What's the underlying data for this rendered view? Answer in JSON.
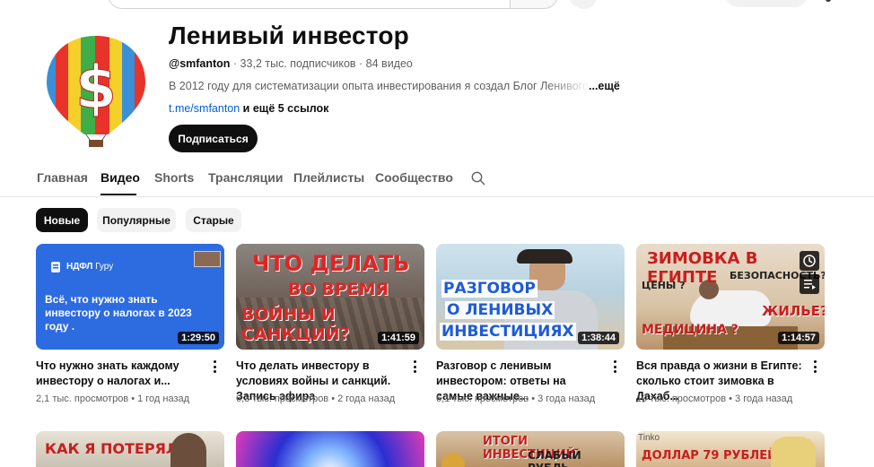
{
  "channel": {
    "name": "Ленивый инвестор",
    "handle": "@smfanton",
    "subscribers": " · 33,2 тыс. подписчиков · 84 видео",
    "description": "В 2012 году для систематизации опыта инвестирования я создал Блог Ленивого",
    "more": "...ещё",
    "link": "t.me/smfanton",
    "links_rest": " и ещё 5 ссылок",
    "subscribe_label": "Подписаться"
  },
  "tabs": [
    {
      "label": "Главная"
    },
    {
      "label": "Видео"
    },
    {
      "label": "Shorts"
    },
    {
      "label": "Трансляции"
    },
    {
      "label": "Плейлисты"
    },
    {
      "label": "Сообщество"
    }
  ],
  "chips": [
    {
      "label": "Новые"
    },
    {
      "label": "Популярные"
    },
    {
      "label": "Старые"
    }
  ],
  "videos": [
    {
      "title": "Что нужно знать каждому инвестору о налогах и...",
      "meta": "2,1 тыс. просмотров • 1 год назад",
      "duration": "1:29:50",
      "thumb_brand": "НДФЛ Гуру",
      "thumb_text": "Всё, что нужно знать инвестору о налогах в 2023 году ."
    },
    {
      "title": "Что делать инвестору в условиях войны и санкций. Запись эфира",
      "meta": "6,3 тыс. просмотров • 2 года назад",
      "duration": "1:41:59",
      "thumb_l1": "ЧТО ДЕЛАТЬ",
      "thumb_l2": "ВО ВРЕМЯ",
      "thumb_l3": "ВОЙНЫ И САНКЦИЙ?"
    },
    {
      "title": "Разговор с ленивым инвестором: ответы на самые важные...",
      "meta": "6,1 тыс. просмотров • 3 года назад",
      "duration": "1:38:44",
      "thumb_l1": "РАЗГОВОР",
      "thumb_l2": "О ЛЕНИВЫХ",
      "thumb_l3": "ИНВЕСТИЦИЯХ"
    },
    {
      "title": "Вся правда о жизни в Египте: сколько стоит зимовка в Дахаб...",
      "meta": "10 тыс. просмотров • 3 года назад",
      "duration": "1:14:57",
      "thumb_l1": "ЗИМОВКА В ЕГИПТЕ",
      "thumb_l2": "БЕЗОПАСНОСТЬ?",
      "thumb_l3": "ЦЕНЫ ?",
      "thumb_l4": "ЖИЛЬЕ?",
      "thumb_l5": "МЕДИЦИНА ?"
    }
  ],
  "next_row": [
    {
      "text": "КАК Я ПОТЕРЯЛ"
    },
    {
      "text": ""
    },
    {
      "text": "ИТОГИ ИНВЕСТИЦИЙ",
      "text2": "СЛАБЫЙ РУБЛЬ"
    },
    {
      "text": "ДОЛЛАР 79 РУБЛЕЙ",
      "text2": "Tinko"
    }
  ]
}
